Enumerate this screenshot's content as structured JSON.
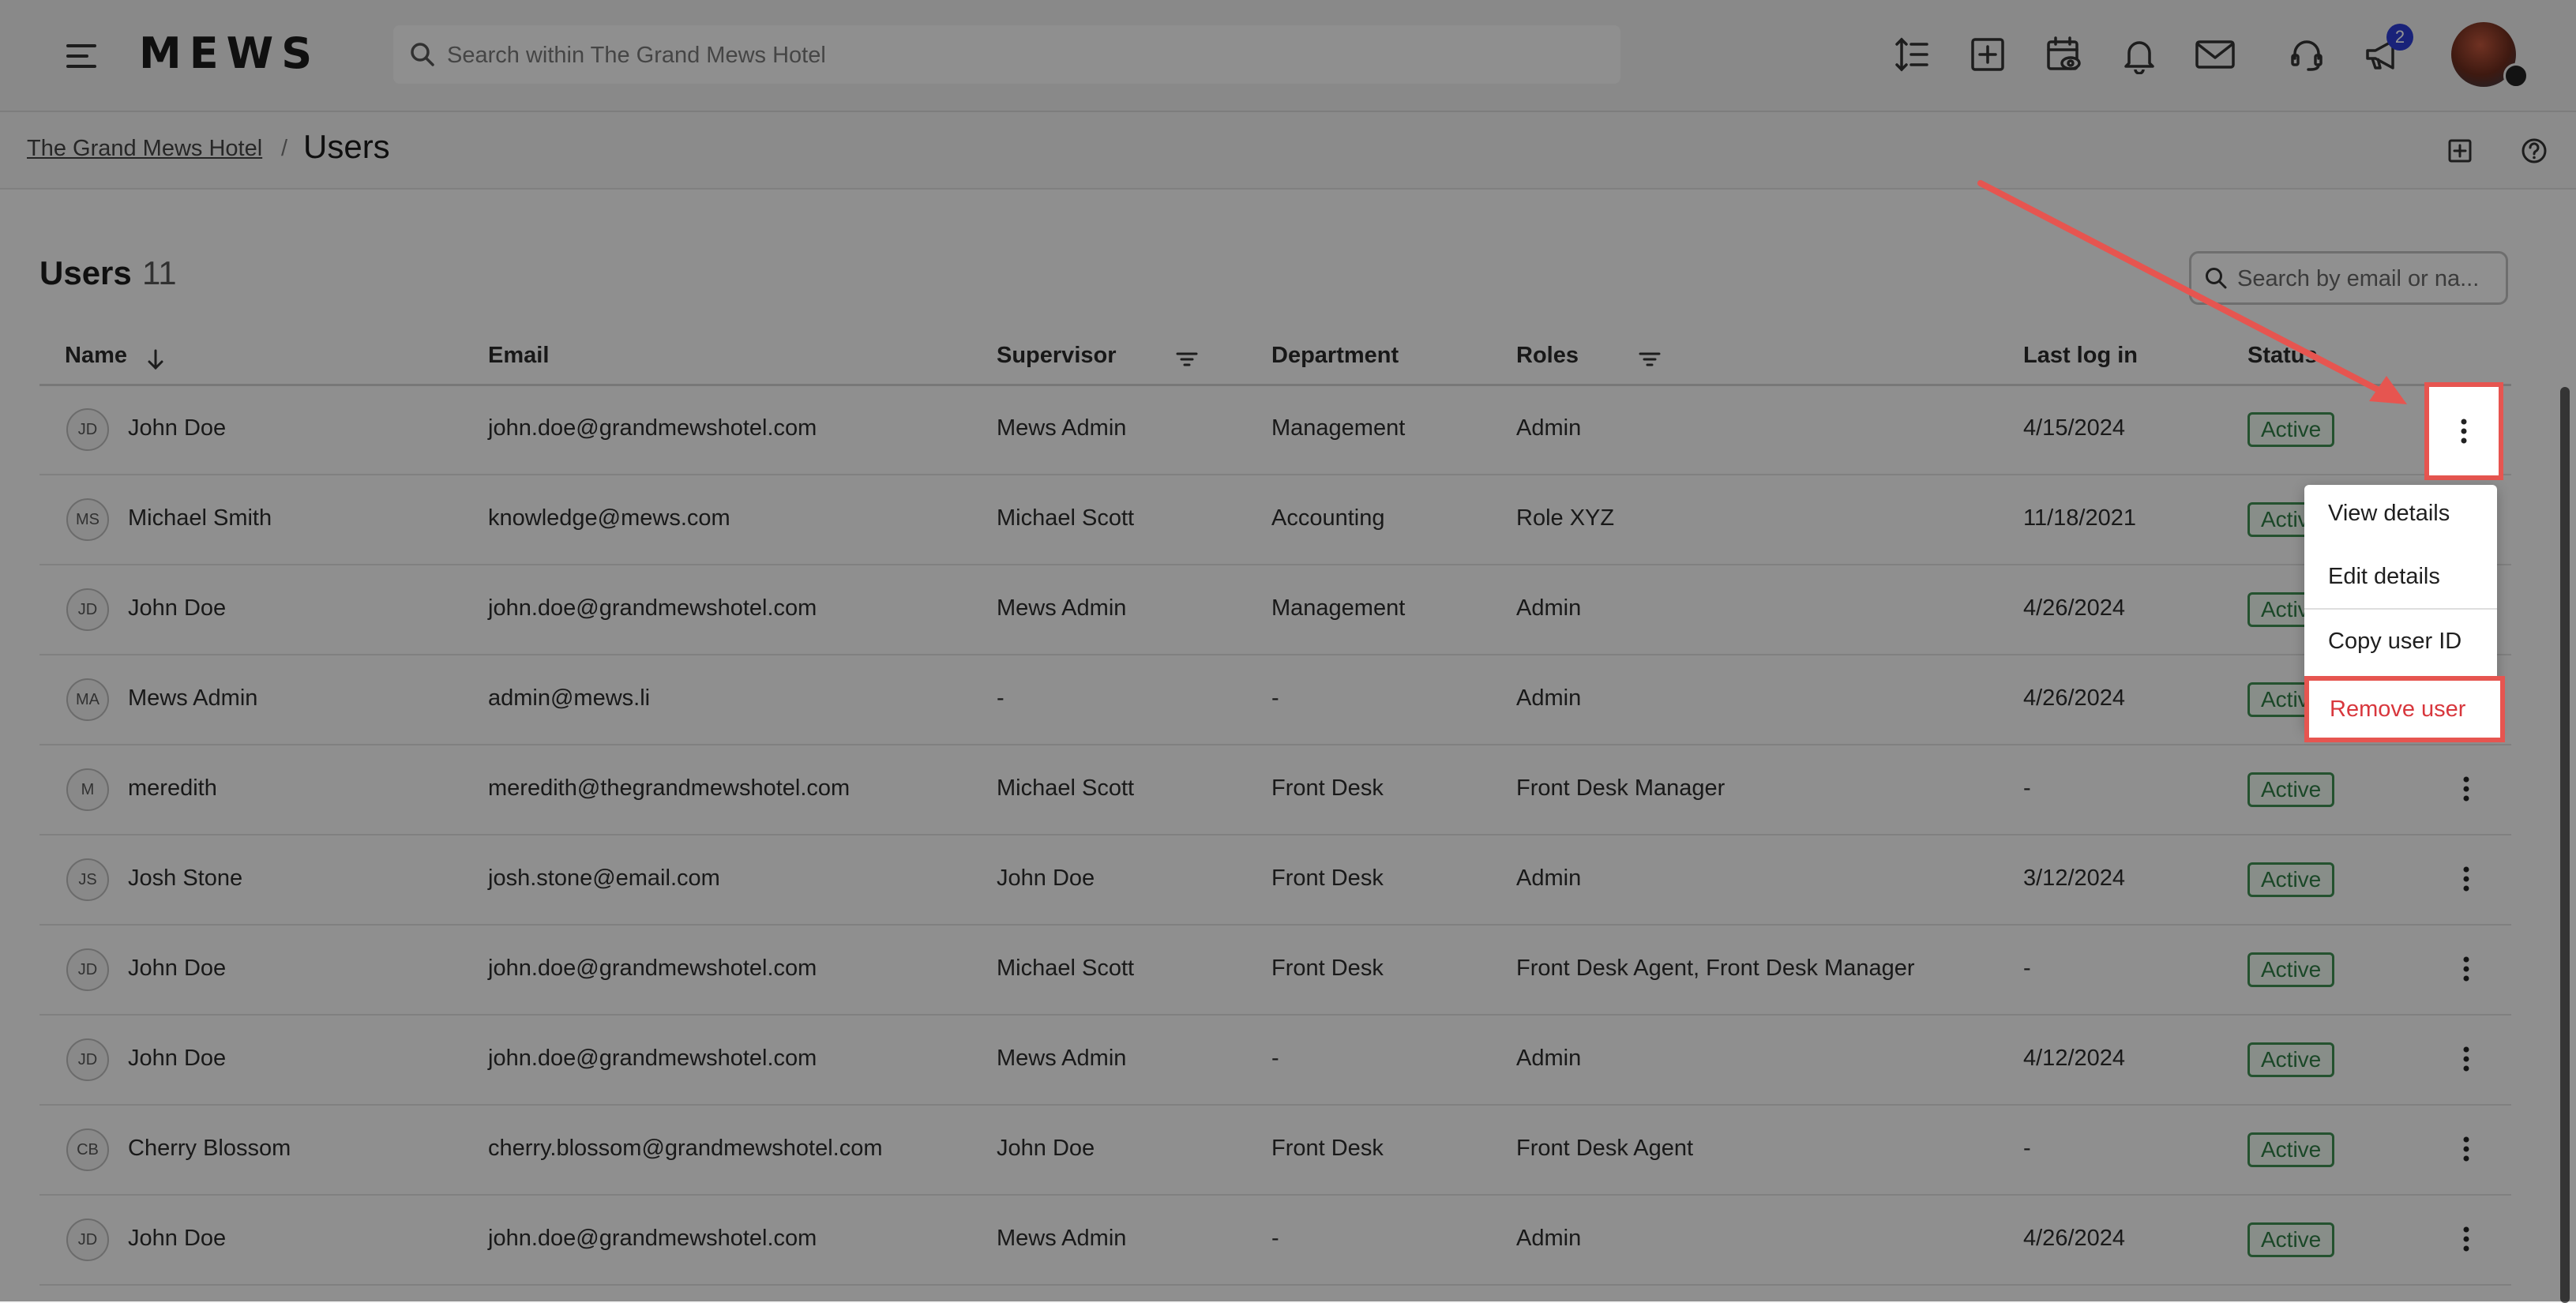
{
  "header": {
    "logo": "MEWS",
    "search_placeholder": "Search within The Grand Mews Hotel",
    "notification_badge": "2",
    "icons": [
      "menu-icon",
      "search-icon",
      "line-spacing-icon",
      "add-square-icon",
      "calendar-eye-icon",
      "bell-icon",
      "mail-icon",
      "headset-icon",
      "megaphone-icon"
    ]
  },
  "breadcrumb": {
    "parent": "The Grand Mews Hotel",
    "separator": "/",
    "current": "Users"
  },
  "users": {
    "title": "Users",
    "count": "11",
    "search_placeholder": "Search by email or na..."
  },
  "table": {
    "columns": {
      "name": "Name",
      "email": "Email",
      "supervisor": "Supervisor",
      "department": "Department",
      "roles": "Roles",
      "last_login": "Last log in",
      "status": "Status"
    },
    "rows": [
      {
        "initials": "JD",
        "name": "John Doe",
        "email": "john.doe@grandmewshotel.com",
        "supervisor": "Mews Admin",
        "department": "Management",
        "roles": "Admin",
        "last_login": "4/15/2024",
        "status": "Active"
      },
      {
        "initials": "MS",
        "name": "Michael Smith",
        "email": "knowledge@mews.com",
        "supervisor": "Michael Scott",
        "department": "Accounting",
        "roles": "Role XYZ",
        "last_login": "11/18/2021",
        "status": "Active"
      },
      {
        "initials": "JD",
        "name": "John Doe",
        "email": "john.doe@grandmewshotel.com",
        "supervisor": "Mews Admin",
        "department": "Management",
        "roles": "Admin",
        "last_login": "4/26/2024",
        "status": "Active"
      },
      {
        "initials": "MA",
        "name": "Mews Admin",
        "email": "admin@mews.li",
        "supervisor": "-",
        "department": "-",
        "roles": "Admin",
        "last_login": "4/26/2024",
        "status": "Active"
      },
      {
        "initials": "M",
        "name": "meredith",
        "email": "meredith@thegrandmewshotel.com",
        "supervisor": "Michael Scott",
        "department": "Front Desk",
        "roles": "Front Desk Manager",
        "last_login": "-",
        "status": "Active"
      },
      {
        "initials": "JS",
        "name": "Josh Stone",
        "email": "josh.stone@email.com",
        "supervisor": "John Doe",
        "department": "Front Desk",
        "roles": "Admin",
        "last_login": "3/12/2024",
        "status": "Active"
      },
      {
        "initials": "JD",
        "name": "John Doe",
        "email": "john.doe@grandmewshotel.com",
        "supervisor": "Michael Scott",
        "department": "Front Desk",
        "roles": "Front Desk Agent, Front Desk Manager",
        "last_login": "-",
        "status": "Active"
      },
      {
        "initials": "JD",
        "name": "John Doe",
        "email": "john.doe@grandmewshotel.com",
        "supervisor": "Mews Admin",
        "department": "-",
        "roles": "Admin",
        "last_login": "4/12/2024",
        "status": "Active"
      },
      {
        "initials": "CB",
        "name": "Cherry Blossom",
        "email": "cherry.blossom@grandmewshotel.com",
        "supervisor": "John Doe",
        "department": "Front Desk",
        "roles": "Front Desk Agent",
        "last_login": "-",
        "status": "Active"
      },
      {
        "initials": "JD",
        "name": "John Doe",
        "email": "john.doe@grandmewshotel.com",
        "supervisor": "Mews Admin",
        "department": "-",
        "roles": "Admin",
        "last_login": "4/26/2024",
        "status": "Active"
      }
    ]
  },
  "context_menu": {
    "view_details": "View details",
    "edit_details": "Edit details",
    "copy_user_id": "Copy user ID",
    "remove_user": "Remove user"
  },
  "colors": {
    "highlight": "#e65550",
    "status_green": "#3e8e52",
    "remove_red": "#d8373d",
    "badge_blue": "#2b3cd0"
  }
}
